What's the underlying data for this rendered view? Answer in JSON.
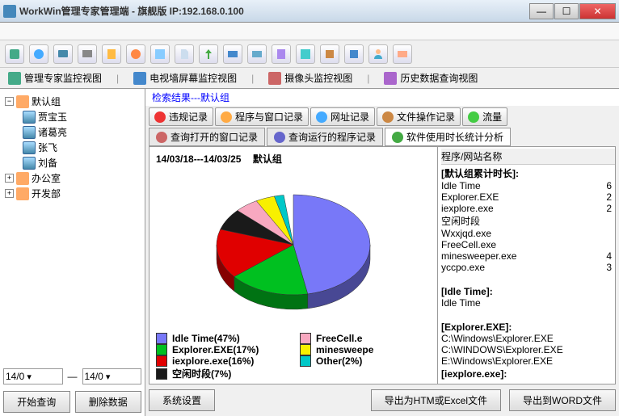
{
  "title": "WorkWin管理专家管理端 - 旗舰版 IP:192.168.0.100",
  "viewtabs": [
    "管理专家监控视图",
    "电视墙屏幕监控视图",
    "摄像头监控视图",
    "历史数据查询视图"
  ],
  "tree": {
    "root": "默认组",
    "members": [
      "贾宝玉",
      "诸葛亮",
      "张飞",
      "刘备"
    ],
    "other_groups": [
      "办公室",
      "开发部"
    ]
  },
  "date_from": "14/0",
  "date_to": "14/0",
  "btn_query": "开始查询",
  "btn_delete": "删除数据",
  "search_result": "检索结果---默认组",
  "rectabs": [
    "违规记录",
    "程序与窗口记录",
    "网址记录",
    "文件操作记录",
    "流量"
  ],
  "subtabs": [
    "查询打开的窗口记录",
    "查询运行的程序记录",
    "软件使用时长统计分析"
  ],
  "chart_range": "14/03/18---14/03/25",
  "chart_group": "默认组",
  "list_header": "程序/网站名称",
  "list": {
    "sec1": "[默认组累计时长]:",
    "items1": [
      {
        "name": "Idle Time",
        "val": "6"
      },
      {
        "name": "Explorer.EXE",
        "val": "2"
      },
      {
        "name": "iexplore.exe",
        "val": "2"
      },
      {
        "name": "空闲时段",
        "val": ""
      },
      {
        "name": "Wxxjqd.exe",
        "val": ""
      },
      {
        "name": "FreeCell.exe",
        "val": ""
      },
      {
        "name": "minesweeper.exe",
        "val": "4"
      },
      {
        "name": "yccpo.exe",
        "val": "3"
      }
    ],
    "sec2": "[Idle Time]:",
    "items2": [
      {
        "name": "Idle Time",
        "val": ""
      }
    ],
    "sec3": "[Explorer.EXE]:",
    "items3": [
      {
        "name": "C:\\Windows\\Explorer.EXE",
        "val": ""
      },
      {
        "name": "C:\\WINDOWS\\Explorer.EXE",
        "val": ""
      },
      {
        "name": "E:\\Windows\\Explorer.EXE",
        "val": ""
      }
    ],
    "sec4": "[iexplore.exe]:"
  },
  "chart_data": {
    "type": "pie",
    "title": "14/03/18---14/03/25  默认组",
    "series": [
      {
        "name": "Idle Time",
        "pct": 47,
        "color": "#7878f8"
      },
      {
        "name": "Explorer.EXE",
        "pct": 17,
        "color": "#00c020"
      },
      {
        "name": "iexplore.exe",
        "pct": 16,
        "color": "#e00000"
      },
      {
        "name": "空闲时段",
        "pct": 7,
        "color": "#1a1a1a"
      },
      {
        "name": "FreeCell.exe",
        "pct": 5,
        "color": "#f8a8c0",
        "label": "FreeCell.e"
      },
      {
        "name": "minesweeper.exe",
        "pct": 4,
        "color": "#f8f000",
        "label": "minesweepe"
      },
      {
        "name": "Other",
        "pct": 2,
        "color": "#00c8c8"
      }
    ]
  },
  "legend_texts": {
    "l0": "Idle Time(47%)",
    "l1": "Explorer.EXE(17%)",
    "l2": "iexplore.exe(16%)",
    "l3": "空闲时段(7%)",
    "l4": "FreeCell.e",
    "l5": "minesweepe",
    "l6": "Other(2%)"
  },
  "bottom": {
    "sys": "系统设置",
    "export_html": "导出为HTM或Excel文件",
    "export_word": "导出到WORD文件"
  }
}
